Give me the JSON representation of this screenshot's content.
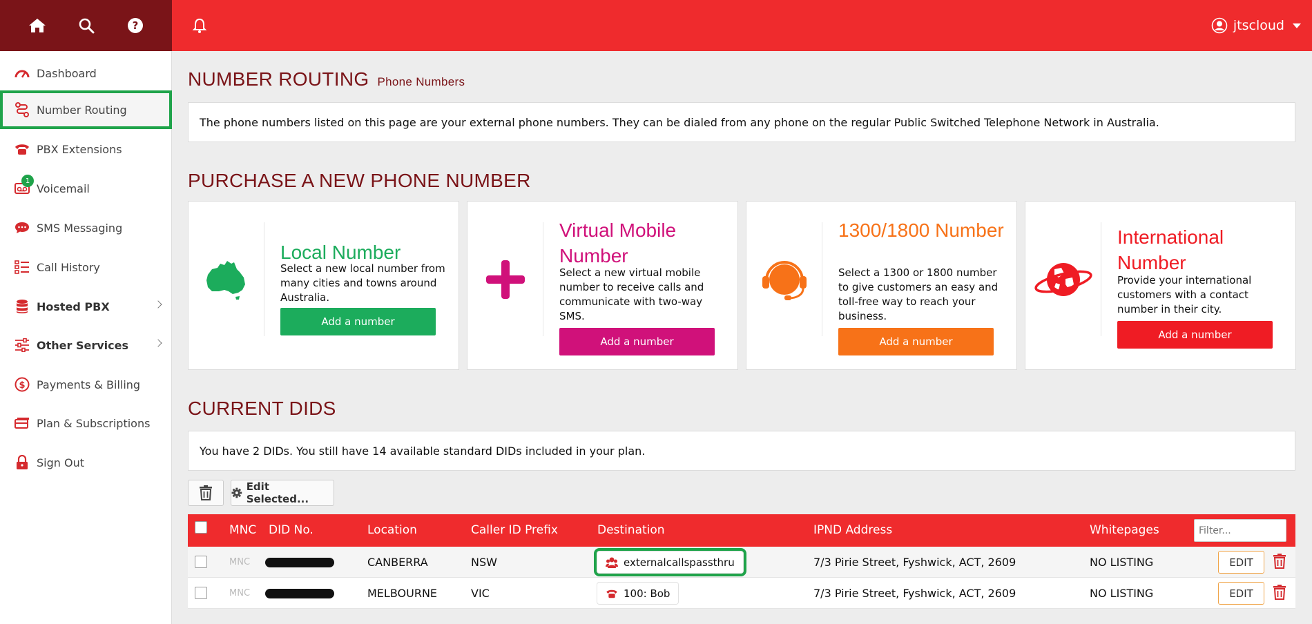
{
  "topbar": {
    "icons": [
      "home-icon",
      "search-icon",
      "help-icon",
      "bell-icon"
    ],
    "user_name": "jtscloud"
  },
  "sidebar": {
    "items": [
      {
        "label": "Dashboard",
        "icon": "speedometer-icon"
      },
      {
        "label": "Number Routing",
        "icon": "routing-icon",
        "active": true
      },
      {
        "label": "PBX Extensions",
        "icon": "phone-icon"
      },
      {
        "label": "Voicemail",
        "icon": "voicemail-icon",
        "badge": "1"
      },
      {
        "label": "SMS Messaging",
        "icon": "chat-icon"
      },
      {
        "label": "Call History",
        "icon": "list-icon"
      },
      {
        "label": "Hosted PBX",
        "icon": "database-icon",
        "expandable": true
      },
      {
        "label": "Other Services",
        "icon": "sliders-icon",
        "expandable": true
      },
      {
        "label": "Payments & Billing",
        "icon": "dollar-icon"
      },
      {
        "label": "Plan & Subscriptions",
        "icon": "card-icon"
      },
      {
        "label": "Sign Out",
        "icon": "lock-icon"
      }
    ]
  },
  "page": {
    "title": "NUMBER ROUTING",
    "subtitle": "Phone Numbers",
    "intro": "The phone numbers listed on this page are your external phone numbers. They can be dialed from any phone on the regular Public Switched Telephone Network in Australia."
  },
  "purchase": {
    "heading": "PURCHASE A NEW PHONE NUMBER",
    "cards": [
      {
        "title": "Local Number",
        "desc": "Select a new local number from many cities and towns around Australia.",
        "button": "Add a number",
        "color": "#1cac5c",
        "icon": "australia-icon"
      },
      {
        "title": "Virtual Mobile Number",
        "desc": "Select a new virtual mobile number to receive calls and communicate with two-way SMS.",
        "button": "Add a number",
        "color": "#d0117a",
        "icon": "plus-icon"
      },
      {
        "title": "1300/1800 Number",
        "desc": "Select a 1300 or 1800 number to give customers an easy and toll-free way to reach your business.",
        "button": "Add a number",
        "color": "#f77218",
        "icon": "headset-icon"
      },
      {
        "title": "International Number",
        "desc": "Provide your international customers with a contact number in their city.",
        "button": "Add a number",
        "color": "#ef1c24",
        "icon": "globe-icon"
      }
    ]
  },
  "dids": {
    "heading": "CURRENT DIDS",
    "summary": "You have 2 DIDs. You still have 14 available standard DIDs included in your plan.",
    "edit_selected": "Edit Selected...",
    "columns": {
      "mnc": "MNC",
      "did": "DID No.",
      "location": "Location",
      "caller_id": "Caller ID Prefix",
      "destination": "Destination",
      "ipnd": "IPND Address",
      "whitepages": "Whitepages"
    },
    "filter_placeholder": "Filter...",
    "rows": [
      {
        "mnc": "MNC",
        "location": "CANBERRA",
        "caller_id": "NSW",
        "destination": "externalcallspassthru",
        "dest_icon": "group-icon",
        "ipnd": "7/3 Pirie Street, Fyshwick, ACT, 2609",
        "whitepages": "NO LISTING",
        "edit": "EDIT"
      },
      {
        "mnc": "MNC",
        "location": "MELBOURNE",
        "caller_id": "VIC",
        "destination": "100: Bob",
        "dest_icon": "phone-icon",
        "ipnd": "7/3 Pirie Street, Fyshwick, ACT, 2609",
        "whitepages": "NO LISTING",
        "edit": "EDIT"
      }
    ]
  },
  "colors": {
    "topbar": "#ef2b2d",
    "topbar_dark": "#7a1418",
    "heading": "#7a1418",
    "highlight": "#1fa34a"
  }
}
